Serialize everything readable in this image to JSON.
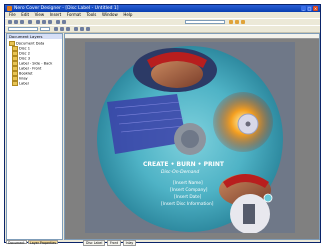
{
  "window": {
    "title": "Nero Cover Designer - [Disc Label - Untitled 1]",
    "minimize": "_",
    "maximize": "□",
    "close": "×"
  },
  "menu": [
    "File",
    "Edit",
    "View",
    "Insert",
    "Format",
    "Tools",
    "Window",
    "Help"
  ],
  "left_pane": {
    "header": "Document Layers",
    "tree": [
      "Document Data",
      "Disc 1",
      "Disc 2",
      "Disc 3",
      "Label - Side - Back",
      "Label - Front",
      "Booklet",
      "Inlay",
      "Label"
    ]
  },
  "disc_label": {
    "headline": "CREATE • BURN • PRINT",
    "subline": "Disc-On-Demand",
    "fields": [
      "[Insert Name]",
      "[Insert Company]",
      "[Insert Date]",
      "[Insert Disc Information]"
    ]
  },
  "bottom_tabs": [
    "Document",
    "Layer Properties"
  ],
  "page_tabs": [
    "Disc Label",
    "Front",
    "Inlay"
  ],
  "colors": {
    "titlebar": "#0a3fb0",
    "disc_teal": "#4fb3c6",
    "background": "#808080"
  }
}
